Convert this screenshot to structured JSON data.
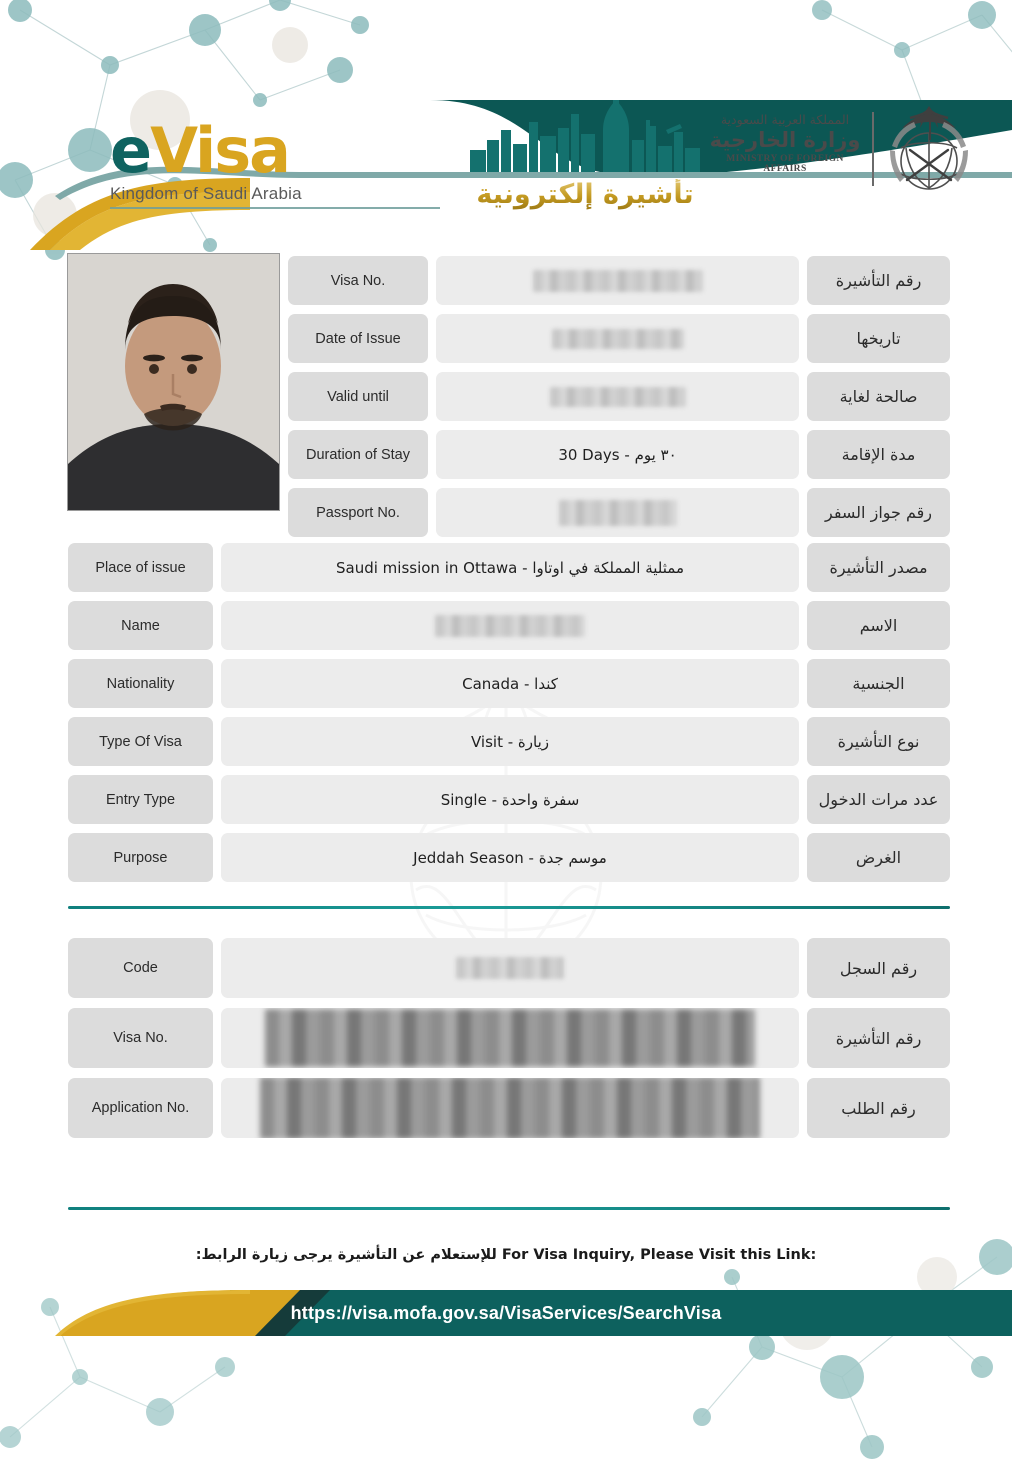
{
  "header": {
    "logo_e": "e",
    "logo_visa": "Visa",
    "logo_subtitle": "Kingdom of Saudi Arabia",
    "evisa_arabic": "تأشيرة إلكترونية",
    "ministry_arabic_country": "المملكة العربية السعودية",
    "ministry_arabic_name": "وزارة الخارجية",
    "ministry_english": "MINISTRY OF FOREIGN AFFAIRS",
    "emblem_name": "saudi-emblem-icon",
    "skyline_name": "city-skyline-icon"
  },
  "photo": {
    "alt": "applicant-photo"
  },
  "top_rows": [
    {
      "label_en": "Visa No.",
      "value": "",
      "label_ar": "رقم التأشيرة",
      "redacted": "light",
      "redact_width": 170,
      "redact_height": 22
    },
    {
      "label_en": "Date of Issue",
      "value": "",
      "label_ar": "تاريخها",
      "redacted": "light",
      "redact_width": 132,
      "redact_height": 20
    },
    {
      "label_en": "Valid until",
      "value": "",
      "label_ar": "صالحة لغاية",
      "redacted": "light",
      "redact_width": 136,
      "redact_height": 20
    },
    {
      "label_en": "Duration of Stay",
      "value": "30 Days - ٣٠ يوم",
      "label_ar": "مدة الإقامة",
      "redacted": "",
      "redact_width": 0,
      "redact_height": 0
    },
    {
      "label_en": "Passport No.",
      "value": "",
      "label_ar": "رقم جواز السفر",
      "redacted": "light",
      "redact_width": 118,
      "redact_height": 26
    }
  ],
  "mid_rows": [
    {
      "label_en": "Place of issue",
      "value": "Saudi mission in Ottawa - ممثلية المملكة في اوتاوا",
      "label_ar": "مصدر التأشيرة",
      "redacted": "",
      "redact_width": 0,
      "redact_height": 0
    },
    {
      "label_en": "Name",
      "value": "",
      "label_ar": "الاسم",
      "redacted": "light",
      "redact_width": 150,
      "redact_height": 22
    },
    {
      "label_en": "Nationality",
      "value": "Canada - كندا",
      "label_ar": "الجنسية",
      "redacted": "",
      "redact_width": 0,
      "redact_height": 0
    },
    {
      "label_en": "Type Of Visa",
      "value": "Visit - زيارة",
      "label_ar": "نوع التأشيرة",
      "redacted": "",
      "redact_width": 0,
      "redact_height": 0
    },
    {
      "label_en": "Entry Type",
      "value": "Single - سفرة واحدة",
      "label_ar": "عدد مرات الدخول",
      "redacted": "",
      "redact_width": 0,
      "redact_height": 0
    },
    {
      "label_en": "Purpose",
      "value": "Jeddah Season - موسم جدة",
      "label_ar": "الغرض",
      "redacted": "",
      "redact_width": 0,
      "redact_height": 0
    }
  ],
  "bottom_rows": [
    {
      "label_en": "Code",
      "value": "",
      "label_ar": "رقم السجل",
      "redacted": "light",
      "redact_width": 108,
      "redact_height": 22
    },
    {
      "label_en": "Visa No.",
      "value": "",
      "label_ar": "رقم التأشيرة",
      "redacted": "heavy",
      "redact_width": 490,
      "redact_height": 58
    },
    {
      "label_en": "Application No.",
      "value": "",
      "label_ar": "رقم الطلب",
      "redacted": "heavy",
      "redact_width": 500,
      "redact_height": 62
    }
  ],
  "footer": {
    "note_arabic": "للإستعلام عن التأشيرة يرجى زيارة الرابط:",
    "note_english": "For Visa Inquiry, Please Visit this Link:",
    "url": "https://visa.mofa.gov.sa/VisaServices/SearchVisa"
  },
  "colors": {
    "teal_dark": "#0f6360",
    "teal": "#1a8a88",
    "gold": "#d9a520",
    "label_bg": "#dcdcdc",
    "value_bg": "#ececec"
  }
}
